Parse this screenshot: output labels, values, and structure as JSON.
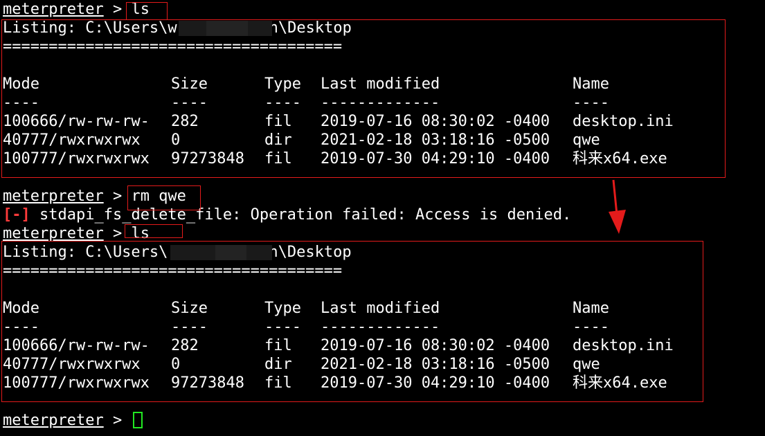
{
  "terminal": {
    "prompt_word": "meterpreter",
    "prompt_sep": " > ",
    "colors": {
      "background": "#000000",
      "text": "#ffffff",
      "error": "#ff3b3b",
      "annotation": "#e41b1b",
      "cursor": "#22e822"
    },
    "commands": {
      "first": "ls",
      "second": "rm qwe",
      "third": "ls"
    },
    "error": {
      "tag": "[-]",
      "message": " stdapi_fs_delete_file: Operation failed: Access is denied."
    },
    "listing": {
      "title_prefix": "Listing: C:\\Users\\",
      "title_start_char": "w",
      "title_suffix": "n\\Desktop",
      "underline": "=====================================",
      "headers": {
        "mode": "Mode",
        "size": "Size",
        "type": "Type",
        "modified": "Last modified",
        "name": "Name"
      },
      "dashes": {
        "mode": "----",
        "size": "----",
        "type": "----",
        "modified": "-------------",
        "name": "----"
      },
      "rows": [
        {
          "mode": "100666/rw-rw-rw-",
          "size": "282",
          "type": "fil",
          "modified": "2019-07-16 08:30:02 -0400",
          "name": "desktop.ini"
        },
        {
          "mode": "40777/rwxrwxrwx",
          "size": "0",
          "type": "dir",
          "modified": "2021-02-18 03:18:16 -0500",
          "name": "qwe"
        },
        {
          "mode": "100777/rwxrwxrwx",
          "size": "97273848",
          "type": "fil",
          "modified": "2019-07-30 04:29:10 -0400",
          "name": "科来x64.exe"
        }
      ]
    }
  }
}
